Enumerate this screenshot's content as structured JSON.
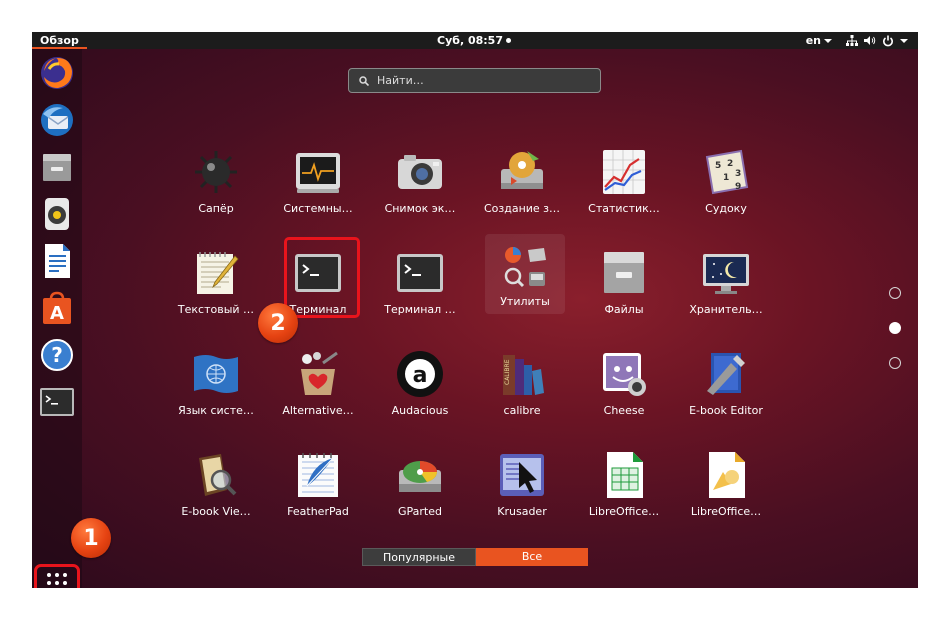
{
  "topbar": {
    "activities": "Обзор",
    "clock": "Суб, 08:57",
    "language": "en"
  },
  "dock": {
    "items": [
      {
        "name": "firefox-icon"
      },
      {
        "name": "thunderbird-icon"
      },
      {
        "name": "files-icon"
      },
      {
        "name": "rhythmbox-icon"
      },
      {
        "name": "writer-icon"
      },
      {
        "name": "software-center-icon"
      },
      {
        "name": "help-icon"
      },
      {
        "name": "terminal-icon"
      }
    ],
    "show_apps_icon": "apps-grid-icon"
  },
  "search": {
    "placeholder": "Найти…"
  },
  "apps": [
    {
      "label": "Сапёр",
      "icon": "minesweeper-icon"
    },
    {
      "label": "Системны…",
      "icon": "system-monitor-icon"
    },
    {
      "label": "Снимок эк…",
      "icon": "screenshot-icon"
    },
    {
      "label": "Создание з…",
      "icon": "startup-disk-icon"
    },
    {
      "label": "Статистик…",
      "icon": "power-statistics-icon"
    },
    {
      "label": "Судоку",
      "icon": "sudoku-icon"
    },
    {
      "label": "Текстовый …",
      "icon": "text-editor-icon"
    },
    {
      "label": "Терминал",
      "icon": "terminal-icon"
    },
    {
      "label": "Терминал …",
      "icon": "terminal-icon"
    },
    {
      "label": "Утилиты",
      "icon": "utilities-folder-icon"
    },
    {
      "label": "Файлы",
      "icon": "files-icon"
    },
    {
      "label": "Хранитель…",
      "icon": "screensaver-icon"
    },
    {
      "label": "Язык систе…",
      "icon": "language-support-icon"
    },
    {
      "label": "Alternative…",
      "icon": "alternative-icon"
    },
    {
      "label": "Audacious",
      "icon": "audacious-icon"
    },
    {
      "label": "calibre",
      "icon": "calibre-icon"
    },
    {
      "label": "Cheese",
      "icon": "cheese-icon"
    },
    {
      "label": "E-book Editor",
      "icon": "ebook-editor-icon"
    },
    {
      "label": "E-book Vie…",
      "icon": "ebook-viewer-icon"
    },
    {
      "label": "FeatherPad",
      "icon": "featherpad-icon"
    },
    {
      "label": "GParted",
      "icon": "gparted-icon"
    },
    {
      "label": "Krusader",
      "icon": "krusader-icon"
    },
    {
      "label": "LibreOffice…",
      "icon": "libreoffice-calc-icon"
    },
    {
      "label": "LibreOffice…",
      "icon": "libreoffice-draw-icon"
    }
  ],
  "annotations": {
    "badge1": "1",
    "badge2": "2"
  },
  "tabs": {
    "frequent": "Популярные",
    "all": "Все"
  },
  "colors": {
    "accent": "#e95420",
    "highlight_red": "#e8141c"
  }
}
